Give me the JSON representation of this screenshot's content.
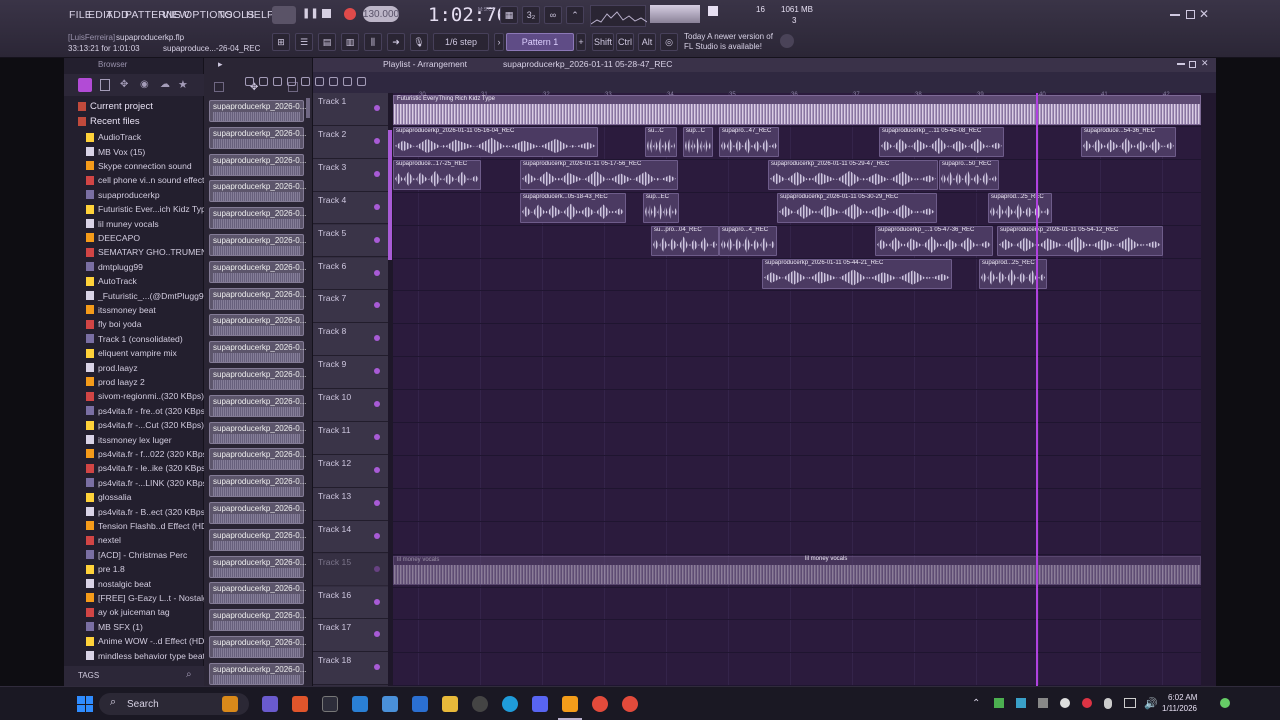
{
  "menu": [
    "FILE",
    "EDIT",
    "ADD",
    "PATTERNS",
    "VIEW",
    "OPTIONS",
    "TOOLS",
    "HELP"
  ],
  "hint": {
    "user": "[LuisFerreira]",
    "project": "supaproducerkp.flp",
    "time_line": "33:13:21 for 1:01:03",
    "file": "supaproduce...-26-04_REC"
  },
  "transport": {
    "tempo": "130.000",
    "time": "1:02:76",
    "mscs": "M:S:CS",
    "cpu_num": "16",
    "ram": "1061 MB",
    "voices": "3",
    "step": "1/6 step",
    "pattern": "Pattern 1",
    "shift": "Shift",
    "ctrl": "Ctrl",
    "alt": "Alt",
    "news_line1": "Today  A newer version of",
    "news_line2": "FL Studio is available!"
  },
  "browser": {
    "title": "Browser",
    "sections": [
      "Current project",
      "Recent files"
    ],
    "items": [
      "AudioTrack",
      "MB Vox (15)",
      "Skype connection sound",
      "cell phone vi..n sound effect",
      "supaproducerkp",
      "Futuristic Ever...ich Kidz Type",
      "lil muney vocals",
      "DEECAPO",
      "SEMATARY GHO..TRUMENTAL",
      "dmtplugg99",
      "AutoTrack",
      "_Futuristic_...(@DmtPlugg99)",
      "itssmoney beat",
      "fly boi yoda",
      "Track 1 (consolidated)",
      "eliquent vampire mix",
      "prod.laayz",
      "prod laayz 2",
      "sivom-regionmi..(320 KBps)",
      "ps4vita.fr - fre..ot (320 KBps)",
      "ps4vita.fr -...Cut (320 KBps)",
      "itssmoney lex luger",
      "ps4vita.fr - f...022 (320 KBps)",
      "ps4vita.fr - le..ike (320 KBps)",
      "ps4vita.fr -...LINK (320 KBps)",
      "glossalia",
      "ps4vita.fr - B..ect (320 KBps)",
      "Tension Flashb..d Effect (HD)",
      "nextel",
      "[ACD] - Christmas Perc",
      "pre 1.8",
      "nostalgic beat",
      "[FREE] G-Eazy L..t - Nostalgic",
      "ay ok juiceman tag",
      "MB SFX (1)",
      "Anime WOW -..d Effect (HD)",
      "mindless behavior type beat"
    ],
    "tags": "TAGS"
  },
  "picker": {
    "clip_label": "supaproducerkp_2026-0...",
    "count": 22
  },
  "playlist": {
    "title": "Playlist - Arrangement",
    "clip_name": "supaproducerkp_2026-01-11 05-28-47_REC",
    "ruler": [
      "30",
      "31",
      "32",
      "33",
      "34",
      "35",
      "36",
      "37",
      "38",
      "39",
      "40",
      "41",
      "42"
    ],
    "tracks": [
      "Track 1",
      "Track 2",
      "Track 3",
      "Track 4",
      "Track 5",
      "Track 6",
      "Track 7",
      "Track 8",
      "Track 9",
      "Track 10",
      "Track 11",
      "Track 12",
      "Track 13",
      "Track 14",
      "Track 15",
      "Track 16",
      "Track 17",
      "Track 18"
    ],
    "clips": {
      "t1_big": "Futuristic EveryThing Rich Kidz Type",
      "c21": "supaproducerkp_2026-01-11 05-16-04_REC",
      "c22": "su...C",
      "c23": "sup...C",
      "c24": "supapro...47_REC",
      "c25": "supaproducerkp_...11 05-45-08_REC",
      "c26": "supaproduce...54-36_REC",
      "c31": "supaproduce...17-25_REC",
      "c32": "supaproducerkp_2026-01-11 05-17-56_REC",
      "c33": "supaproducerkp_2026-01-11 05-29-47_REC",
      "c34": "supapro...50_REC",
      "c41": "supaproducerk...05-18-43_REC",
      "c42": "sup...EC",
      "c43": "supaproducerkp_2026-01-11 05-30-29_REC",
      "c44": "supaprod...25_REC",
      "c51": "su...pro...04_REC",
      "c52": "supapro...4_REC",
      "c53": "supaproducerkp_...1 05-47-36_REC",
      "c54": "supaproducerkp_2026-01-11 05-54-12_REC",
      "c61": "supaproducerkp_2026-01-11 05-44-21_REC",
      "c62": "supaprod...25_REC",
      "t15_a": "lil money vocals",
      "t15_b": "lil money vocals"
    }
  },
  "taskbar": {
    "search": "Search",
    "time": "6:02 AM",
    "date": "1/11/2026"
  }
}
